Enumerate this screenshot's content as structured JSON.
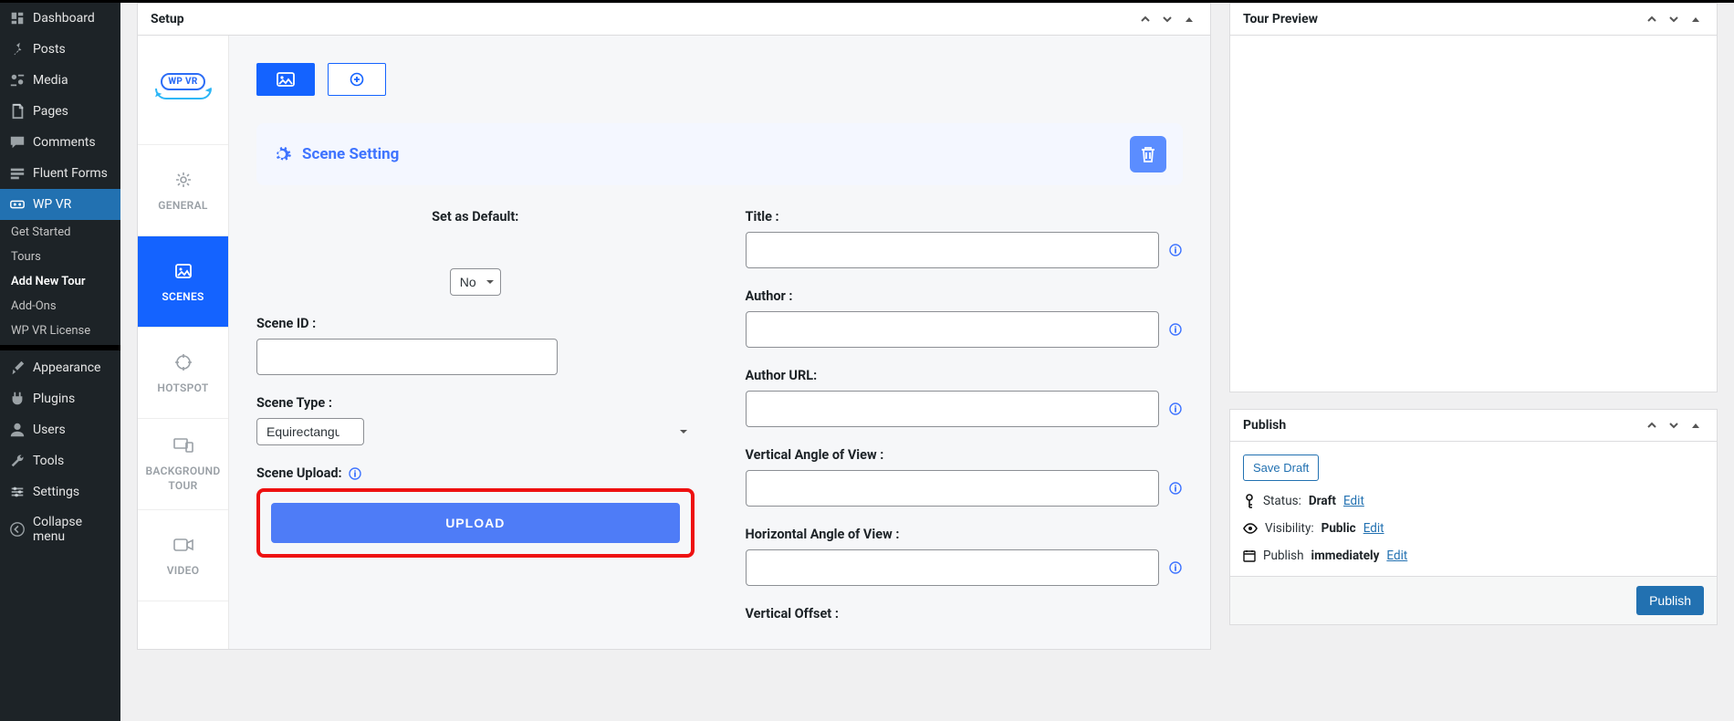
{
  "sidebar": {
    "items": [
      {
        "label": "Dashboard",
        "icon": "dashboard-icon"
      },
      {
        "label": "Posts",
        "icon": "pin-icon"
      },
      {
        "label": "Media",
        "icon": "media-icon"
      },
      {
        "label": "Pages",
        "icon": "pages-icon"
      },
      {
        "label": "Comments",
        "icon": "comment-icon"
      },
      {
        "label": "Fluent Forms",
        "icon": "form-icon"
      },
      {
        "label": "WP VR",
        "icon": "vr-icon"
      }
    ],
    "wpvr_sub": [
      {
        "label": "Get Started"
      },
      {
        "label": "Tours"
      },
      {
        "label": "Add New Tour"
      },
      {
        "label": "Add-Ons"
      },
      {
        "label": "WP VR License"
      }
    ],
    "items_after": [
      {
        "label": "Appearance",
        "icon": "brush-icon"
      },
      {
        "label": "Plugins",
        "icon": "plugin-icon"
      },
      {
        "label": "Users",
        "icon": "user-icon"
      },
      {
        "label": "Tools",
        "icon": "wrench-icon"
      },
      {
        "label": "Settings",
        "icon": "settings-icon"
      },
      {
        "label": "Collapse menu",
        "icon": "collapse-icon"
      }
    ]
  },
  "setup": {
    "panel_title": "Setup",
    "logo_text": "WP VR",
    "vtabs": {
      "general": "GENERAL",
      "scenes": "SCENES",
      "hotspot": "HOTSPOT",
      "bgtour": "BACKGROUND TOUR",
      "video": "VIDEO"
    },
    "scene_header": "Scene Setting",
    "form": {
      "set_default_label": "Set as Default:",
      "set_default_value": "No",
      "scene_id_label": "Scene ID :",
      "scene_type_label": "Scene Type :",
      "scene_type_value": "Equirectangular",
      "scene_upload_label": "Scene Upload:",
      "upload_button": "UPLOAD",
      "title_label": "Title :",
      "author_label": "Author :",
      "author_url_label": "Author URL:",
      "vaov_label": "Vertical Angle of View :",
      "haov_label": "Horizontal Angle of View :",
      "voffset_label": "Vertical Offset :"
    }
  },
  "tour_preview": {
    "panel_title": "Tour Preview"
  },
  "publish": {
    "panel_title": "Publish",
    "save_draft": "Save Draft",
    "status_label": "Status:",
    "status_value": "Draft",
    "status_edit": "Edit",
    "visibility_label": "Visibility:",
    "visibility_value": "Public",
    "visibility_edit": "Edit",
    "schedule_label": "Publish",
    "schedule_value": "immediately",
    "schedule_edit": "Edit",
    "publish_button": "Publish"
  }
}
